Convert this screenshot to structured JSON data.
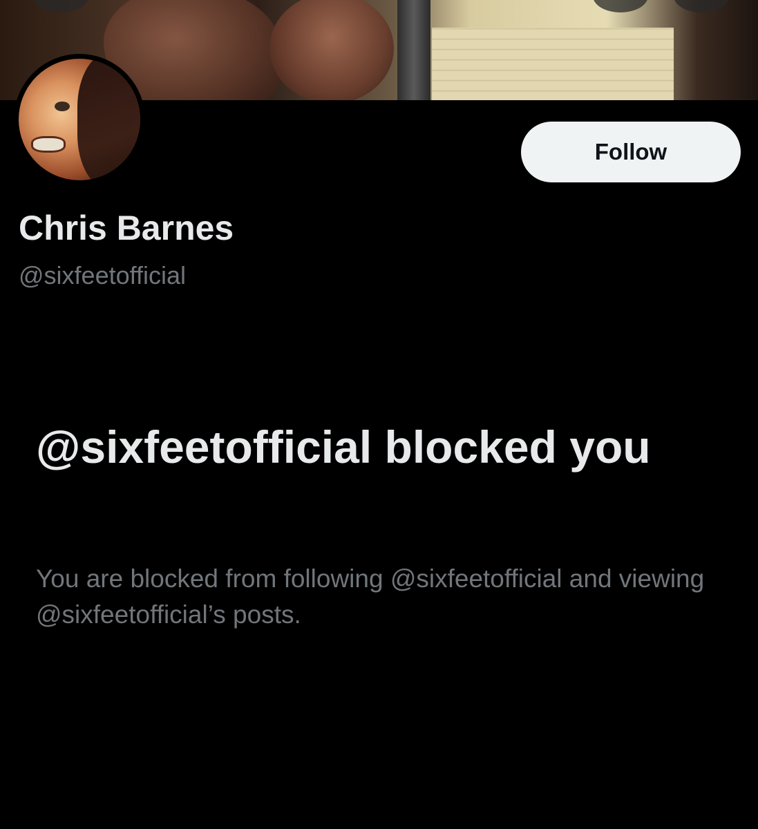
{
  "profile": {
    "display_name": "Chris Barnes",
    "handle": "@sixfeetofficial",
    "follow_label": "Follow"
  },
  "blocked_notice": {
    "title": "@sixfeetofficial blocked you",
    "description": "You are blocked from following @sixfeetofficial and viewing @sixfeetofficial’s posts."
  },
  "colors": {
    "background": "#000000",
    "primary_text": "#e7e9ea",
    "secondary_text": "#71767b",
    "follow_button_bg": "#eff3f4",
    "follow_button_text": "#0f1419"
  }
}
